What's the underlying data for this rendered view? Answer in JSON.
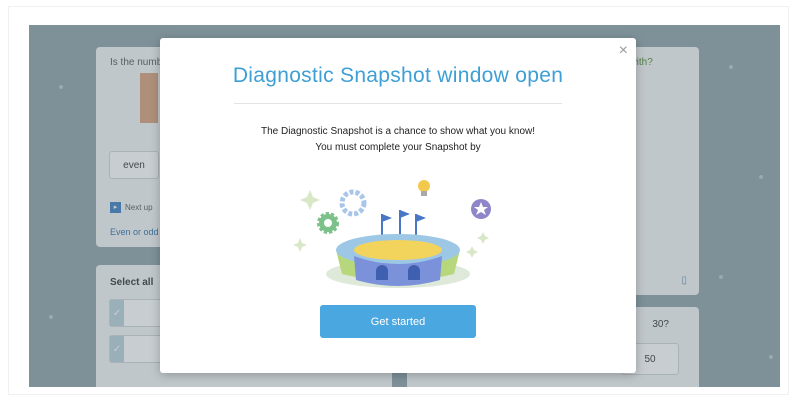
{
  "background": {
    "left_card": {
      "question": "Is the numb",
      "answer_even": "even",
      "next_up_label": "Next up",
      "link_text": "Even or odd"
    },
    "right_card": {
      "question_fragment": "art with?"
    },
    "lower_left_card": {
      "prompt": "Select all"
    },
    "lower_right_card": {
      "question_fragment": "30?",
      "answer_option": "50"
    }
  },
  "modal": {
    "title": "Diagnostic Snapshot window open",
    "line1": "The Diagnostic Snapshot is a chance to show what you know!",
    "line2": "You must complete your Snapshot by",
    "close_glyph": "×",
    "button_label": "Get started"
  },
  "colors": {
    "accent": "#3e9fd5",
    "button": "#4ba7e0",
    "backdrop": "#8fa3ab"
  },
  "icons": [
    "close-icon",
    "next-up-icon",
    "book-icon",
    "check-icon",
    "stadium-illustration"
  ]
}
